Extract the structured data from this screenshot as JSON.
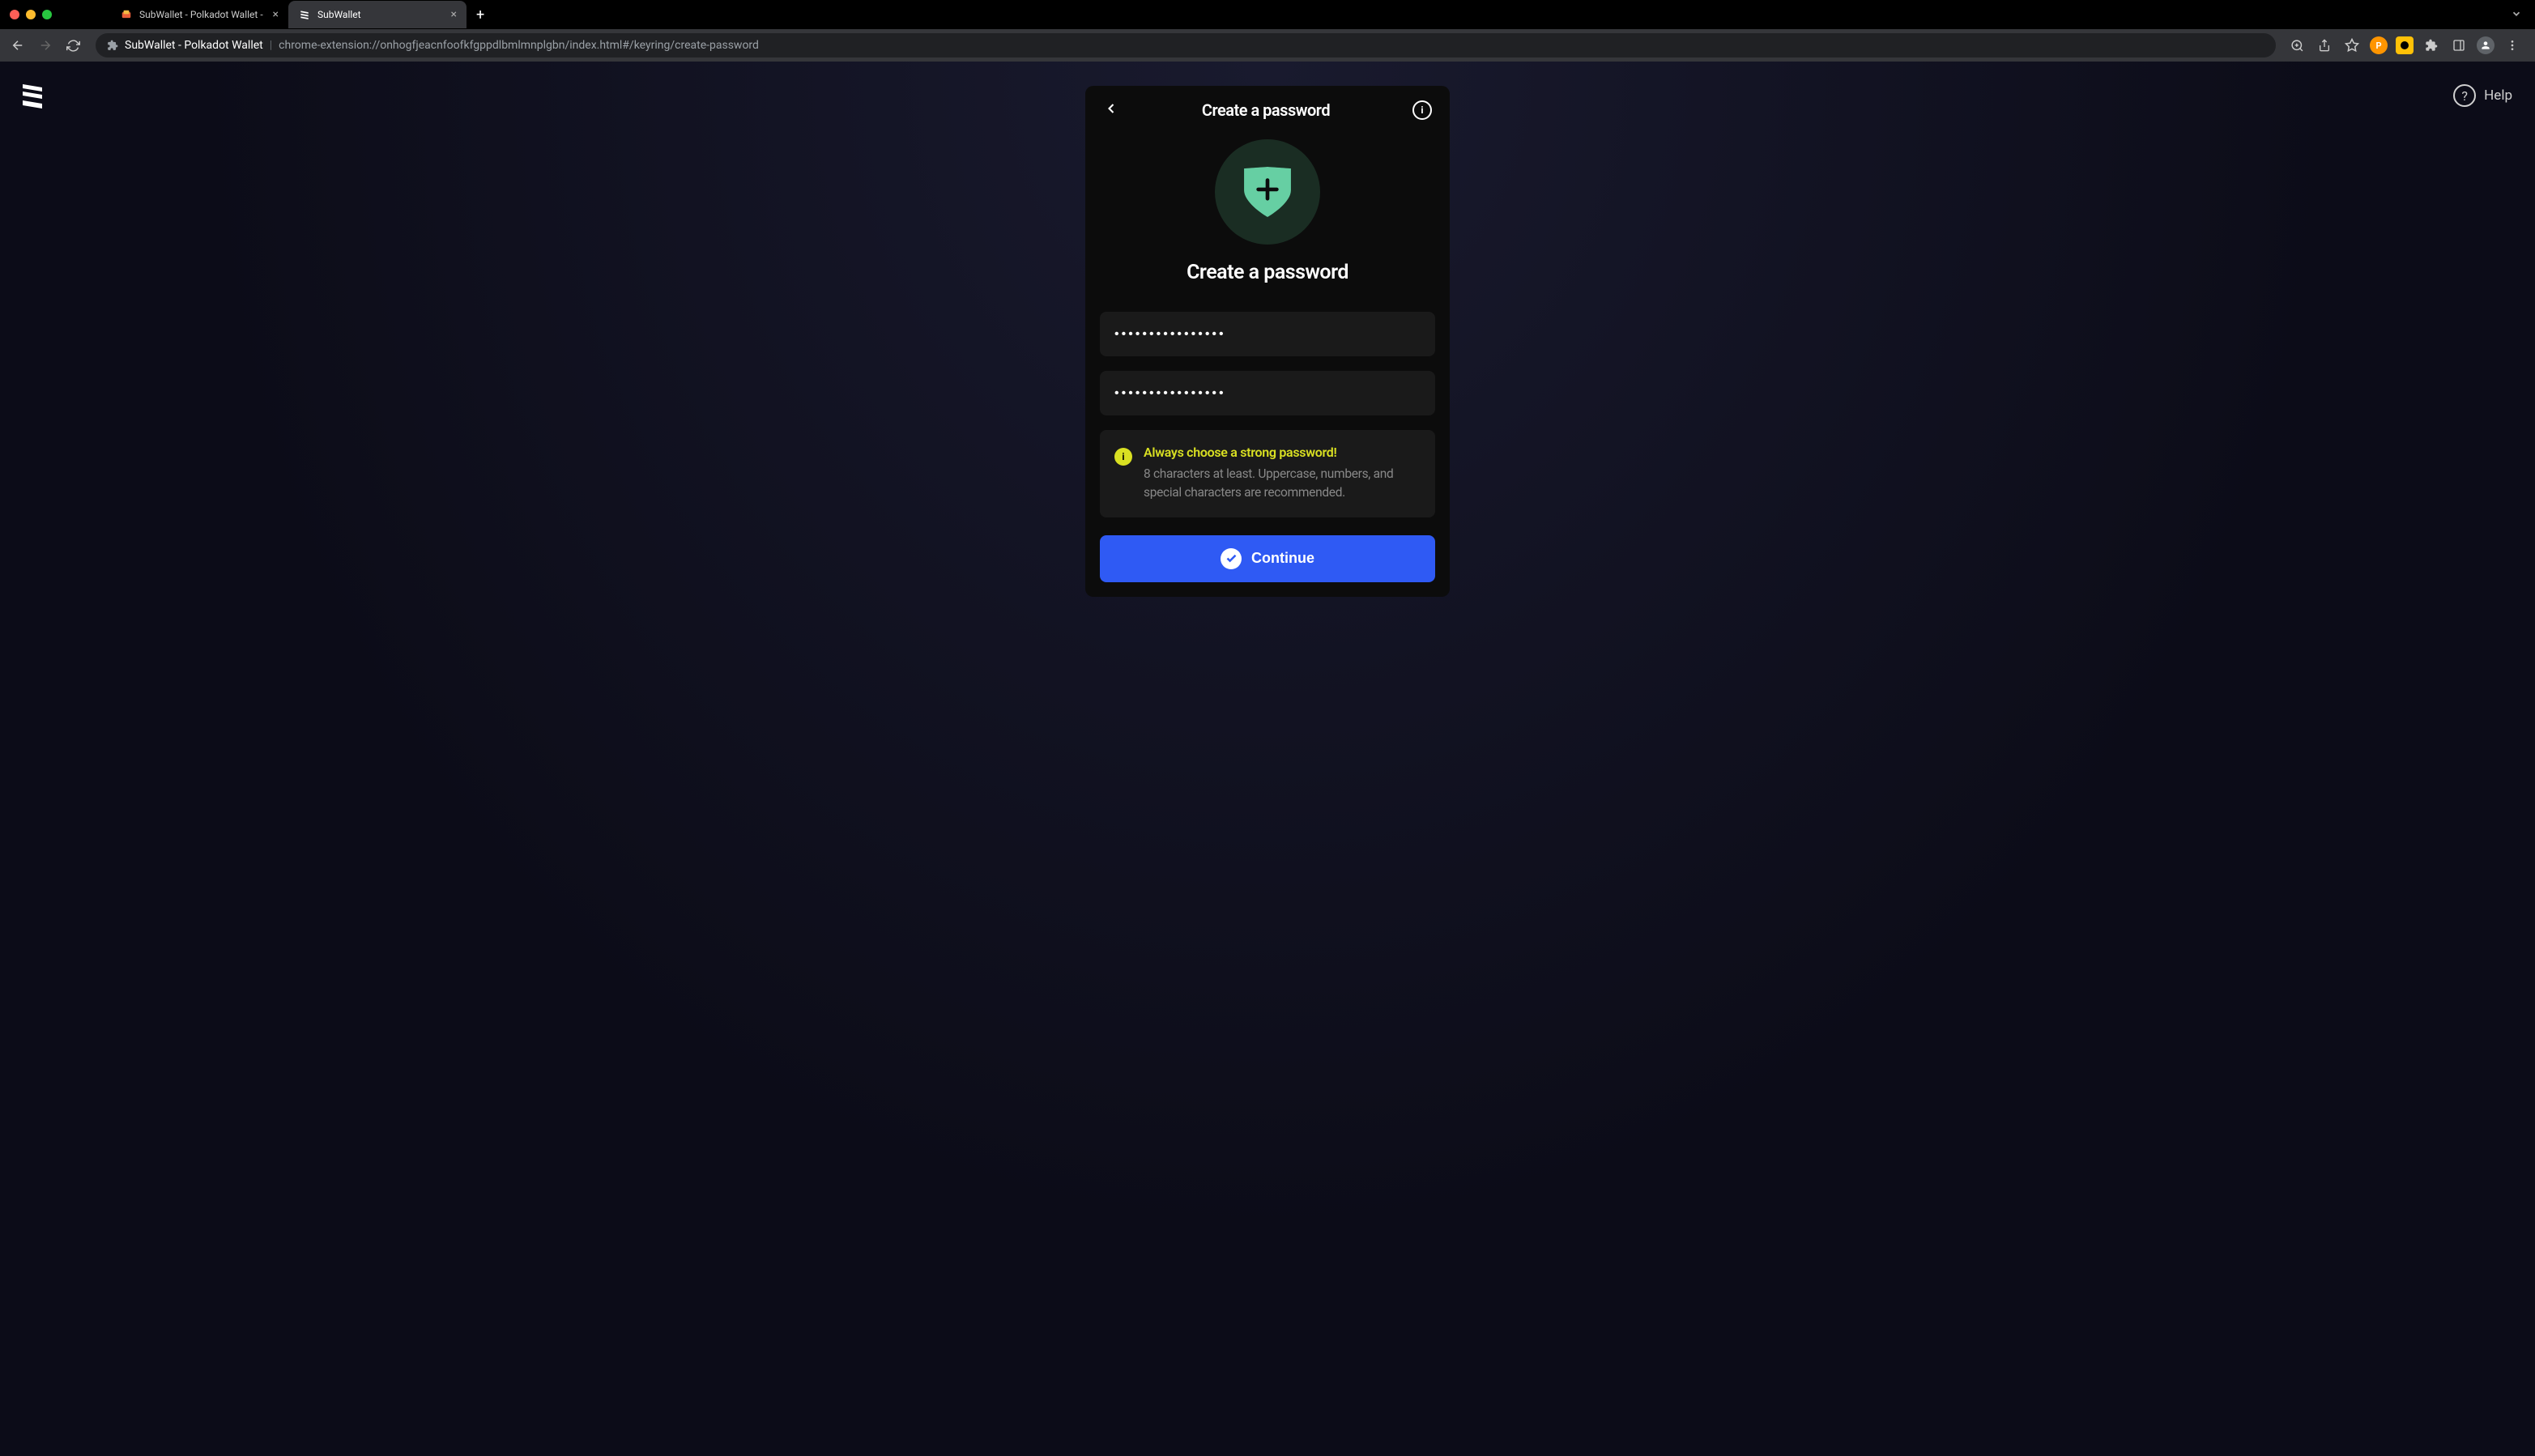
{
  "browser": {
    "tabs": [
      {
        "title": "SubWallet - Polkadot Wallet - ",
        "active": false
      },
      {
        "title": "SubWallet",
        "active": true
      }
    ],
    "url": {
      "site_label": "SubWallet - Polkadot Wallet",
      "path": "chrome-extension://onhogfjeacnfoofkfgppdlbmlmnplgbn/index.html#/keyring/create-password"
    }
  },
  "help": {
    "label": "Help"
  },
  "modal": {
    "header_title": "Create a password",
    "main_title": "Create a password",
    "password_value": "••••••••••••••••",
    "confirm_value": "••••••••••••••••",
    "info_title": "Always choose a strong password!",
    "info_body": "8 characters at least. Uppercase, numbers, and special characters are recommended.",
    "continue_label": "Continue"
  },
  "colors": {
    "accent": "#2f5af4",
    "shield": "#66cfa3",
    "warning": "#d9e022"
  }
}
